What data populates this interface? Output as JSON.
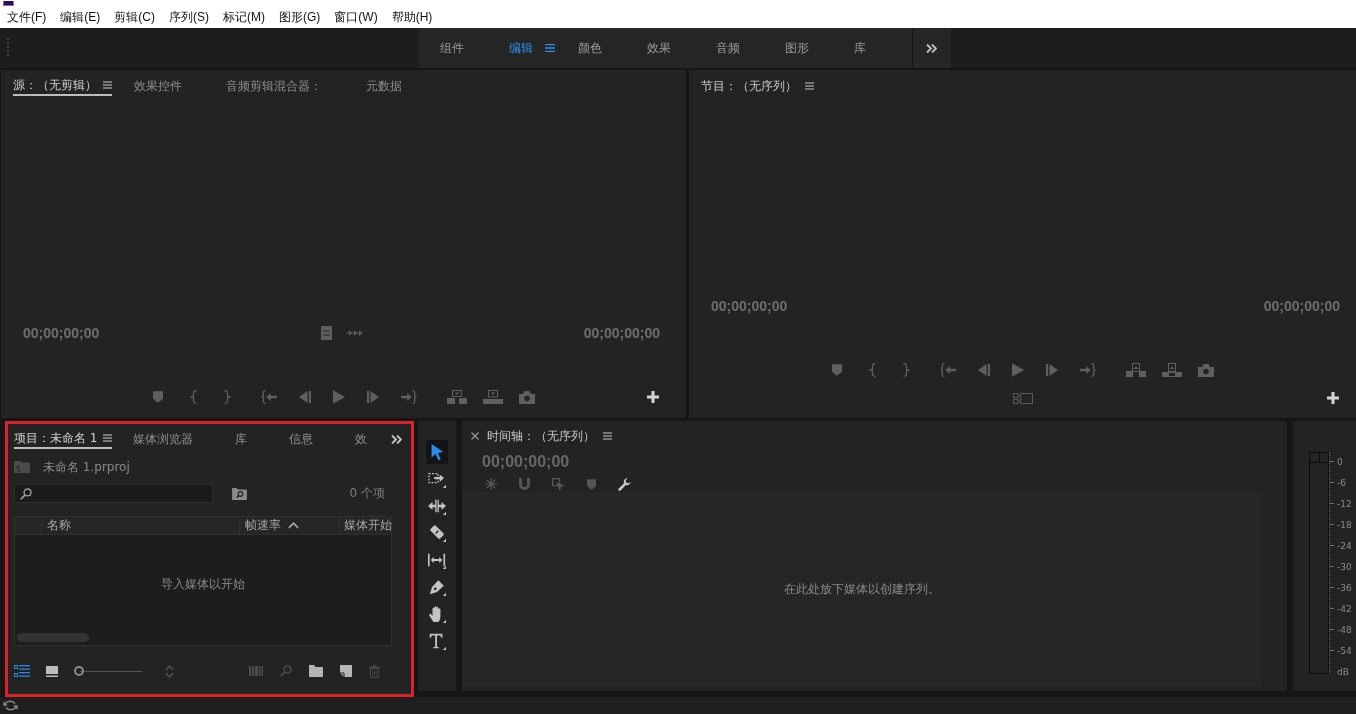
{
  "menu_bar": {
    "items": [
      "文件(F)",
      "编辑(E)",
      "剪辑(C)",
      "序列(S)",
      "标记(M)",
      "图形(G)",
      "窗口(W)",
      "帮助(H)"
    ]
  },
  "workspace_bar": {
    "tabs": [
      {
        "label": "组件",
        "selected": false
      },
      {
        "label": "编辑",
        "selected": true
      },
      {
        "label": "颜色",
        "selected": false
      },
      {
        "label": "效果",
        "selected": false
      },
      {
        "label": "音频",
        "selected": false
      },
      {
        "label": "图形",
        "selected": false
      },
      {
        "label": "库",
        "selected": false
      }
    ]
  },
  "source_monitor": {
    "tabs": [
      {
        "label": "源：（无剪辑）",
        "selected": true
      },
      {
        "label": "效果控件",
        "selected": false
      },
      {
        "label": "音频剪辑混合器：",
        "selected": false
      },
      {
        "label": "元数据",
        "selected": false
      }
    ],
    "timecode_left": "00;00;00;00",
    "timecode_right": "00;00;00;00"
  },
  "program_monitor": {
    "title": "节目：（无序列）",
    "timecode_left": "00;00;00;00",
    "timecode_right": "00;00;00;00"
  },
  "project_panel": {
    "highlighted": true,
    "tabs": [
      {
        "label": "项目：未命名 1",
        "selected": true
      },
      {
        "label": "媒体浏览器",
        "selected": false
      },
      {
        "label": "库",
        "selected": false
      },
      {
        "label": "信息",
        "selected": false
      },
      {
        "label": "效",
        "selected": false
      }
    ],
    "project_file": "未命名 1.prproj",
    "item_count": "0 个项",
    "table": {
      "columns": [
        {
          "label": "名称",
          "sorted": false
        },
        {
          "label": "帧速率",
          "sorted": true
        },
        {
          "label": "媒体开始",
          "sorted": false
        }
      ],
      "empty_message": "导入媒体以开始"
    },
    "view_modes": [
      {
        "kind": "list",
        "selected": true
      },
      {
        "kind": "icon",
        "selected": false
      }
    ],
    "zoom_slider": {
      "level": 0
    }
  },
  "tools": [
    {
      "kind": "selection",
      "selected": true
    },
    {
      "kind": "track-select",
      "selected": false
    },
    {
      "kind": "ripple-edit",
      "selected": false
    },
    {
      "kind": "razor",
      "selected": false
    },
    {
      "kind": "slip",
      "selected": false
    },
    {
      "kind": "pen",
      "selected": false
    },
    {
      "kind": "hand",
      "selected": false
    },
    {
      "kind": "type",
      "selected": false
    }
  ],
  "timeline": {
    "title": "时间轴：（无序列）",
    "timecode": "00;00;00;00",
    "empty_message": "在此处放下媒体以创建序列。"
  },
  "audio_meter": {
    "scale": [
      "0",
      "-6",
      "-12",
      "-18",
      "-24",
      "-30",
      "-36",
      "-42",
      "-48",
      "-54"
    ],
    "unit": "dB"
  }
}
